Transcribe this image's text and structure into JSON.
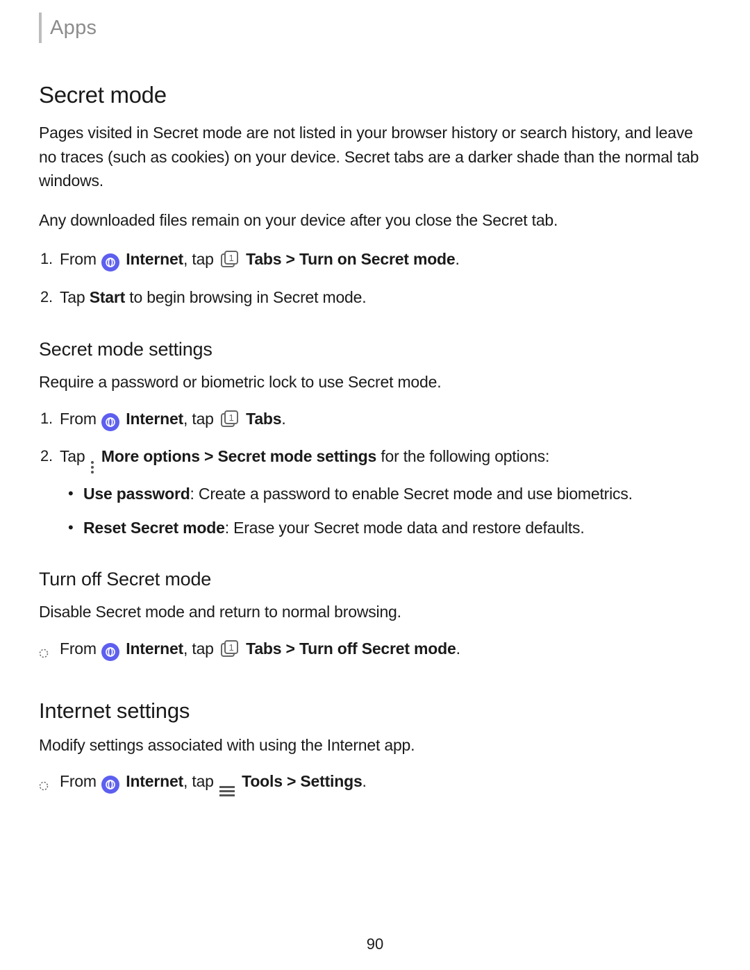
{
  "header": {
    "breadcrumb": "Apps"
  },
  "secret_mode": {
    "heading": "Secret mode",
    "p1": "Pages visited in Secret mode are not listed in your browser history or search history, and leave no traces (such as cookies) on your device. Secret tabs are a darker shade than the normal tab windows.",
    "p2": "Any downloaded files remain on your device after you close the Secret tab.",
    "step1_from": "From ",
    "step1_internet": "Internet",
    "step1_tap": ", tap ",
    "step1_rest": "Tabs > Turn on Secret mode",
    "step2_pre": "Tap ",
    "step2_start": "Start",
    "step2_post": " to begin browsing in Secret mode."
  },
  "settings": {
    "heading": "Secret mode settings",
    "p1": "Require a password or biometric lock to use Secret mode.",
    "step1_from": "From ",
    "step1_internet": "Internet",
    "step1_tap": ", tap ",
    "step1_tabs": "Tabs",
    "step2_pre": "Tap ",
    "step2_more": "More options > Secret mode settings",
    "step2_post": " for the following options:",
    "bullet1_label": "Use password",
    "bullet1_text": ": Create a password to enable Secret mode and use biometrics.",
    "bullet2_label": "Reset Secret mode",
    "bullet2_text": ": Erase your Secret mode data and restore defaults."
  },
  "turnoff": {
    "heading": "Turn off Secret mode",
    "p1": "Disable Secret mode and return to normal browsing.",
    "item_from": "From ",
    "item_internet": "Internet",
    "item_tap": ", tap ",
    "item_rest": "Tabs > Turn off Secret mode"
  },
  "internet_settings": {
    "heading": "Internet settings",
    "p1": "Modify settings associated with using the Internet app.",
    "item_from": "From ",
    "item_internet": "Internet",
    "item_tap": ", tap ",
    "item_rest": "Tools > Settings"
  },
  "page_number": "90"
}
